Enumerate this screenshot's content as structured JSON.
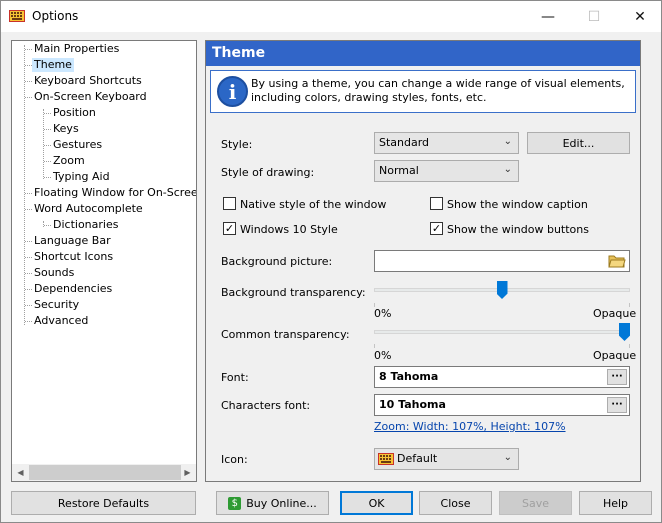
{
  "window": {
    "title": "Options",
    "icon": "keyboard-icon",
    "min_glyph": "—",
    "max_glyph": "☐",
    "close_glyph": "✕"
  },
  "tree": {
    "items": [
      {
        "label": "Main Properties"
      },
      {
        "label": "Theme",
        "selected": true
      },
      {
        "label": "Keyboard Shortcuts"
      },
      {
        "label": "On-Screen Keyboard"
      },
      {
        "label": "Position"
      },
      {
        "label": "Keys"
      },
      {
        "label": "Gestures"
      },
      {
        "label": "Zoom"
      },
      {
        "label": "Typing Aid"
      },
      {
        "label": "Floating Window for On-Screen Keyboard"
      },
      {
        "label": "Word Autocomplete"
      },
      {
        "label": "Dictionaries"
      },
      {
        "label": "Language Bar"
      },
      {
        "label": "Shortcut Icons"
      },
      {
        "label": "Sounds"
      },
      {
        "label": "Dependencies"
      },
      {
        "label": "Security"
      },
      {
        "label": "Advanced"
      }
    ],
    "scroll_left": "◀",
    "scroll_right": "▶"
  },
  "panel": {
    "header": "Theme",
    "info_icon_glyph": "i",
    "info_text": "By using a theme, you can change a wide range of visual elements, including colors, drawing styles, fonts, etc.",
    "style": {
      "label": "Style:",
      "value": "Standard",
      "edit_button": "Edit..."
    },
    "drawing": {
      "label": "Style of drawing:",
      "value": "Normal"
    },
    "checkboxes": {
      "native": {
        "label": "Native style of the window",
        "checked": false
      },
      "caption": {
        "label": "Show the window caption",
        "checked": false
      },
      "win10": {
        "label": "Windows 10 Style",
        "checked": true
      },
      "buttons": {
        "label": "Show the window buttons",
        "checked": true
      }
    },
    "background_picture": {
      "label": "Background picture:",
      "value": ""
    },
    "bg_transparency": {
      "label": "Background transparency:",
      "min_label": "0%",
      "max_label": "Opaque",
      "level": 0.5
    },
    "common_transparency": {
      "label": "Common transparency:",
      "min_label": "0%",
      "max_label": "Opaque",
      "level": 1.0
    },
    "font": {
      "label": "Font:",
      "value": "8 Tahoma",
      "browse": "···"
    },
    "chars_font": {
      "label": "Characters font:",
      "value": "10 Tahoma",
      "browse": "···"
    },
    "zoom_link": "Zoom: Width: 107%, Height: 107%",
    "icon": {
      "label": "Icon:",
      "value": "Default"
    },
    "dropdown_arrow": "⌄"
  },
  "buttons": {
    "restore": "Restore Defaults",
    "buy": "Buy Online...",
    "ok": "OK",
    "close": "Close",
    "save": "Save",
    "help": "Help"
  },
  "colors": {
    "header_bg": "#3165c8",
    "selection_bg": "#cce8ff",
    "accent": "#0078d7",
    "link": "#0645ad"
  }
}
